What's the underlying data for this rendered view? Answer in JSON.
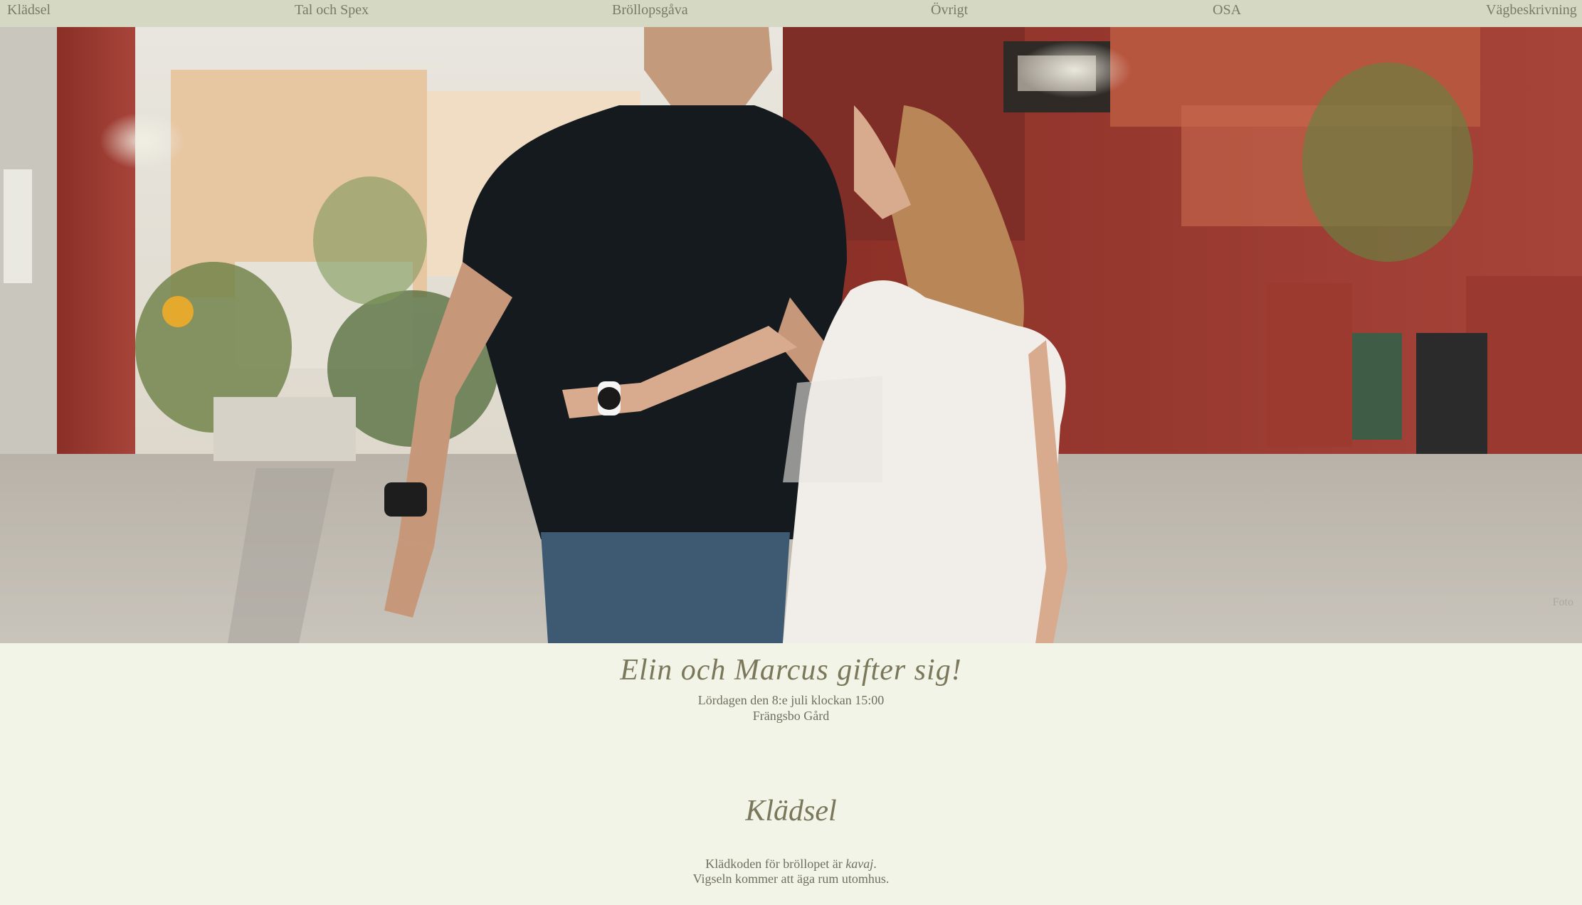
{
  "nav": {
    "items": [
      {
        "label": "Klädsel"
      },
      {
        "label": "Tal och Spex"
      },
      {
        "label": "Bröllopsgåva"
      },
      {
        "label": "Övrigt"
      },
      {
        "label": "OSA"
      },
      {
        "label": "Vägbeskrivning"
      }
    ]
  },
  "hero": {
    "photo_credit": "Foto"
  },
  "intro": {
    "title": "Elin och Marcus gifter sig!",
    "date_line": "Lördagen den 8:e juli klockan 15:00",
    "venue_line": "Frängsbo Gård"
  },
  "dresscode": {
    "heading": "Klädsel",
    "line1_prefix": "Klädkoden för bröllopet är ",
    "line1_emphasis": "kavaj",
    "line1_suffix": ".",
    "line2": "Vigseln kommer att äga rum utomhus."
  },
  "colors": {
    "nav_background": "#d5d9c4",
    "page_background": "#f3f4e8",
    "heading_color": "#7a775a",
    "text_color": "#6f6f5e"
  }
}
